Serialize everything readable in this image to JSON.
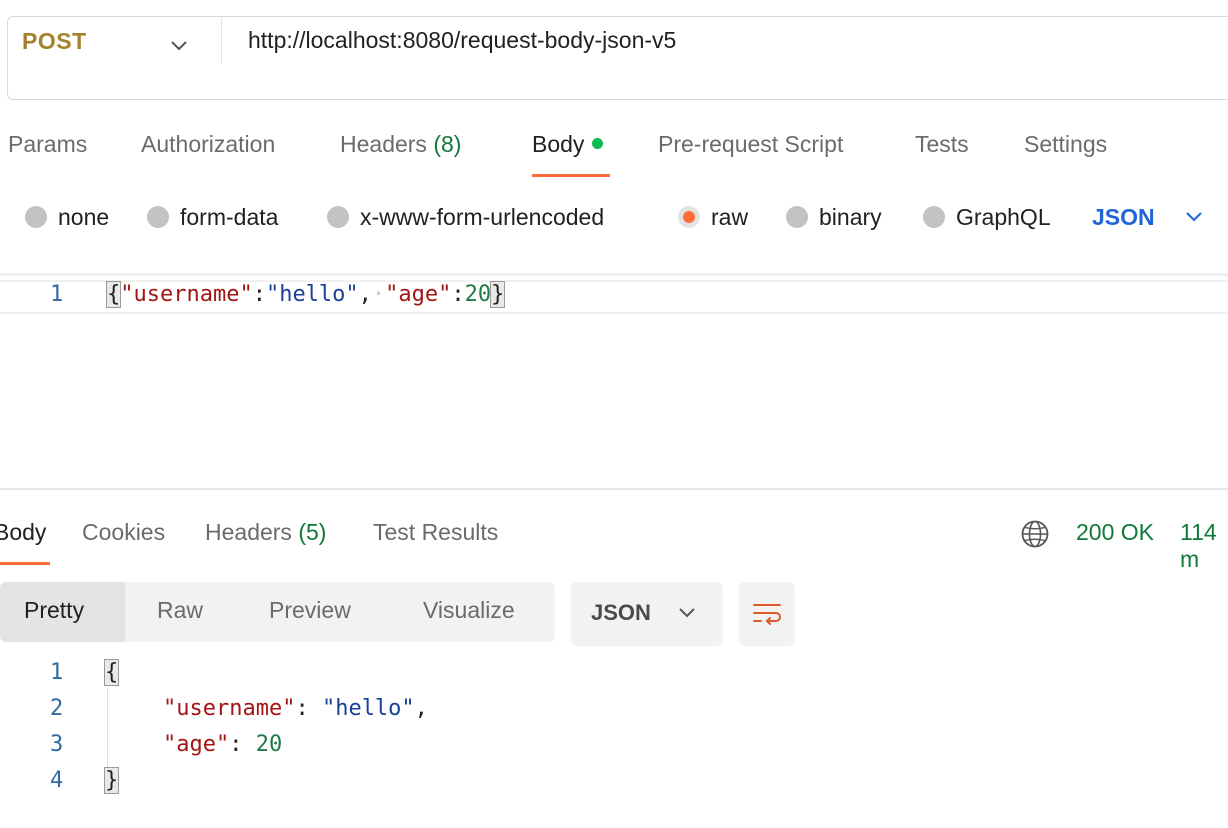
{
  "request": {
    "method": "POST",
    "url": "http://localhost:8080/request-body-json-v5"
  },
  "request_tabs": [
    {
      "label": "Params"
    },
    {
      "label": "Authorization"
    },
    {
      "label": "Headers",
      "count": "(8)"
    },
    {
      "label": "Body",
      "active": true
    },
    {
      "label": "Pre-request Script"
    },
    {
      "label": "Tests"
    },
    {
      "label": "Settings"
    }
  ],
  "body_types": {
    "options": [
      "none",
      "form-data",
      "x-www-form-urlencoded",
      "raw",
      "binary",
      "GraphQL"
    ],
    "selected": "raw",
    "format": "JSON"
  },
  "request_editor": {
    "line_number": "1",
    "open_brace": "{",
    "key1": "\"username\"",
    "colon": ":",
    "val1": "\"hello\"",
    "comma": ",",
    "space_marker": "·",
    "key2": "\"age\"",
    "val2": "20",
    "close_brace": "}"
  },
  "response_tabs": [
    {
      "label": "Body",
      "active": true
    },
    {
      "label": "Cookies"
    },
    {
      "label": "Headers",
      "count": "(5)"
    },
    {
      "label": "Test Results"
    }
  ],
  "response_status": {
    "status": "200 OK",
    "time": "114 m"
  },
  "view_modes": [
    "Pretty",
    "Raw",
    "Preview",
    "Visualize"
  ],
  "view_mode_selected": "Pretty",
  "response_format": "JSON",
  "response_body": {
    "line_numbers": [
      "1",
      "2",
      "3",
      "4"
    ],
    "open_brace": "{",
    "key1": "\"username\"",
    "colon": ": ",
    "val1": "\"hello\"",
    "comma": ",",
    "key2": "\"age\"",
    "val2": "20",
    "close_brace": "}"
  },
  "colors": {
    "accent": "#ff6c37",
    "method": "#a4822c",
    "status_ok": "#0f7a3a",
    "json_link": "#1f65d6"
  },
  "icons": [
    "chevron-down-icon",
    "globe-icon",
    "wrap-lines-icon"
  ]
}
